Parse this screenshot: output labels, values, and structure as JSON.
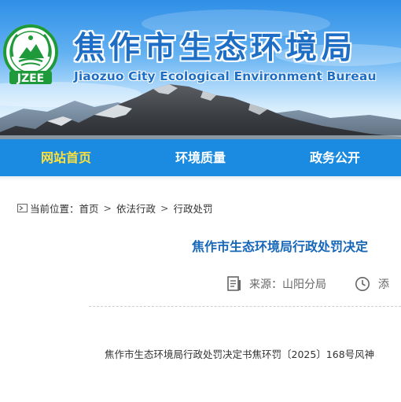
{
  "header": {
    "title": "焦作市生态环境局",
    "subtitle": "Jiaozuo City Ecological Environment Bureau",
    "logo_text": "JZEE"
  },
  "nav": {
    "items": [
      {
        "label": "网站首页",
        "active": true
      },
      {
        "label": "环境质量",
        "active": false
      },
      {
        "label": "政务公开",
        "active": false
      }
    ]
  },
  "breadcrumb": {
    "prefix": "当前位置：",
    "items": [
      "首页",
      "依法行政",
      "行政处罚"
    ],
    "separator": ">"
  },
  "article": {
    "title": "焦作市生态环境局行政处罚决定",
    "source_label": "来源：",
    "source_value": "山阳分局",
    "date_label": "添",
    "body_first_line": "焦作市生态环境局行政处罚决定书焦环罚〔2025〕168号风神"
  },
  "colors": {
    "nav_bg": "#1a8be0",
    "nav_active": "#ffe03a",
    "title_blue": "#1767b8",
    "logo_green": "#1f9a3a"
  },
  "icons": [
    "location-icon",
    "document-icon",
    "clock-icon"
  ]
}
